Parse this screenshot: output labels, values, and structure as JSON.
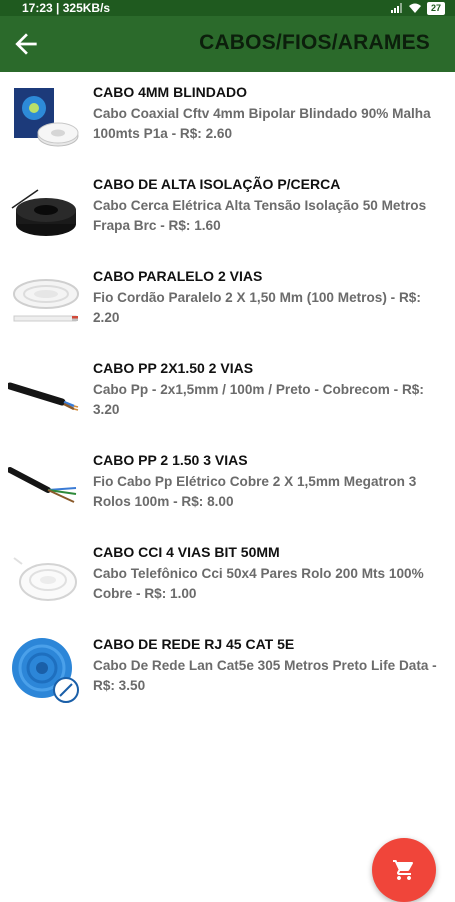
{
  "status_bar": {
    "time_speed": "17:23 | 325KB/s",
    "battery": "27"
  },
  "header": {
    "title": "CABOS/FIOS/ARAMES"
  },
  "items": [
    {
      "title": "CABO 4MM BLINDADO",
      "description": "Cabo Coaxial Cftv 4mm Bipolar Blindado 90% Malha 100mts  P1a - R$: 2.60"
    },
    {
      "title": "CABO DE ALTA ISOLAÇÃO P/CERCA",
      "description": "Cabo Cerca Elétrica Alta Tensão Isolação 50 Metros Frapa Brc - R$: 1.60"
    },
    {
      "title": "CABO PARALELO 2 VIAS",
      "description": "Fio Cordão Paralelo 2 X 1,50 Mm (100 Metros) - R$: 2.20"
    },
    {
      "title": "CABO PP 2X1.50 2 VIAS",
      "description": "Cabo Pp - 2x1,5mm / 100m / Preto - Cobrecom - R$: 3.20"
    },
    {
      "title": "CABO PP 2 1.50 3 VIAS",
      "description": "Fio Cabo Pp Elétrico Cobre 2 X 1,5mm Megatron 3 Rolos 100m - R$: 8.00"
    },
    {
      "title": "CABO CCI 4 VIAS BIT 50MM",
      "description": "Cabo Telefônico Cci 50x4 Pares Rolo 200 Mts 100% Cobre - R$: 1.00"
    },
    {
      "title": "CABO DE REDE RJ 45 CAT 5E",
      "description": "Cabo De Rede Lan Cat5e 305 Metros Preto Life Data - R$: 3.50"
    }
  ],
  "icons": {
    "back": "arrow-back-icon",
    "cart": "shopping-cart-icon"
  },
  "colors": {
    "app_bar": "#2b6a2b",
    "status_bar": "#1f5a1f",
    "fab": "#f0453a"
  }
}
